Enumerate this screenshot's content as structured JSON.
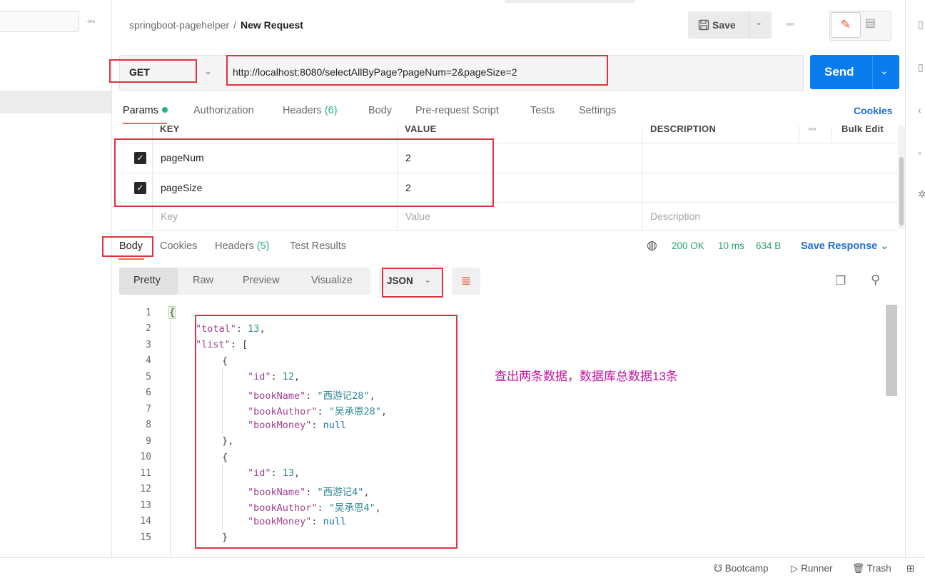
{
  "breadcrumb": {
    "collection": "springboot-pagehelper",
    "separator": "/",
    "request": "New Request"
  },
  "toolbar": {
    "save_label": "Save",
    "more": "◦◦◦"
  },
  "request": {
    "method": "GET",
    "url": "http://localhost:8080/selectAllByPage?pageNum=2&pageSize=2",
    "send_label": "Send"
  },
  "req_tabs": {
    "params": "Params",
    "authorization": "Authorization",
    "headers": "Headers",
    "headers_count": "(6)",
    "body": "Body",
    "prerequest": "Pre-request Script",
    "tests": "Tests",
    "settings": "Settings",
    "cookies": "Cookies"
  },
  "params_table": {
    "headers": {
      "key": "KEY",
      "value": "VALUE",
      "description": "DESCRIPTION",
      "more": "◦◦◦",
      "bulk": "Bulk Edit"
    },
    "rows": [
      {
        "key": "pageNum",
        "value": "2",
        "checked": true
      },
      {
        "key": "pageSize",
        "value": "2",
        "checked": true
      }
    ],
    "placeholder": {
      "key": "Key",
      "value": "Value",
      "description": "Description"
    }
  },
  "resp_tabs": {
    "body": "Body",
    "cookies": "Cookies",
    "headers": "Headers",
    "headers_count": "(5)",
    "test_results": "Test Results"
  },
  "resp_status": {
    "code": "200 OK",
    "time": "10 ms",
    "size": "634 B",
    "save_response": "Save Response"
  },
  "format": {
    "pretty": "Pretty",
    "raw": "Raw",
    "preview": "Preview",
    "visualize": "Visualize",
    "language": "JSON"
  },
  "code": {
    "line_numbers": [
      "1",
      "2",
      "3",
      "4",
      "5",
      "6",
      "7",
      "8",
      "9",
      "10",
      "11",
      "12",
      "13",
      "14",
      "15"
    ],
    "l1": "{",
    "total_key": "\"total\"",
    "total_val": "13",
    "list_key": "\"list\"",
    "list_open": "[",
    "obj_open": "{",
    "obj_close1": "},",
    "obj_close2": "}",
    "id_key": "\"id\"",
    "bookName_key": "\"bookName\"",
    "bookAuthor_key": "\"bookAuthor\"",
    "bookMoney_key": "\"bookMoney\"",
    "item1": {
      "id": "12",
      "bookName": "\"西游记28\"",
      "bookAuthor": "\"吴承恩28\"",
      "bookMoney": "null"
    },
    "item2": {
      "id": "13",
      "bookName": "\"西游记4\"",
      "bookAuthor": "\"吴承恩4\"",
      "bookMoney": "null"
    }
  },
  "annotation": "查出两条数据，数据库总数据13条",
  "footer": {
    "bootcamp": "Bootcamp",
    "runner": "Runner",
    "trash": "Trash"
  }
}
